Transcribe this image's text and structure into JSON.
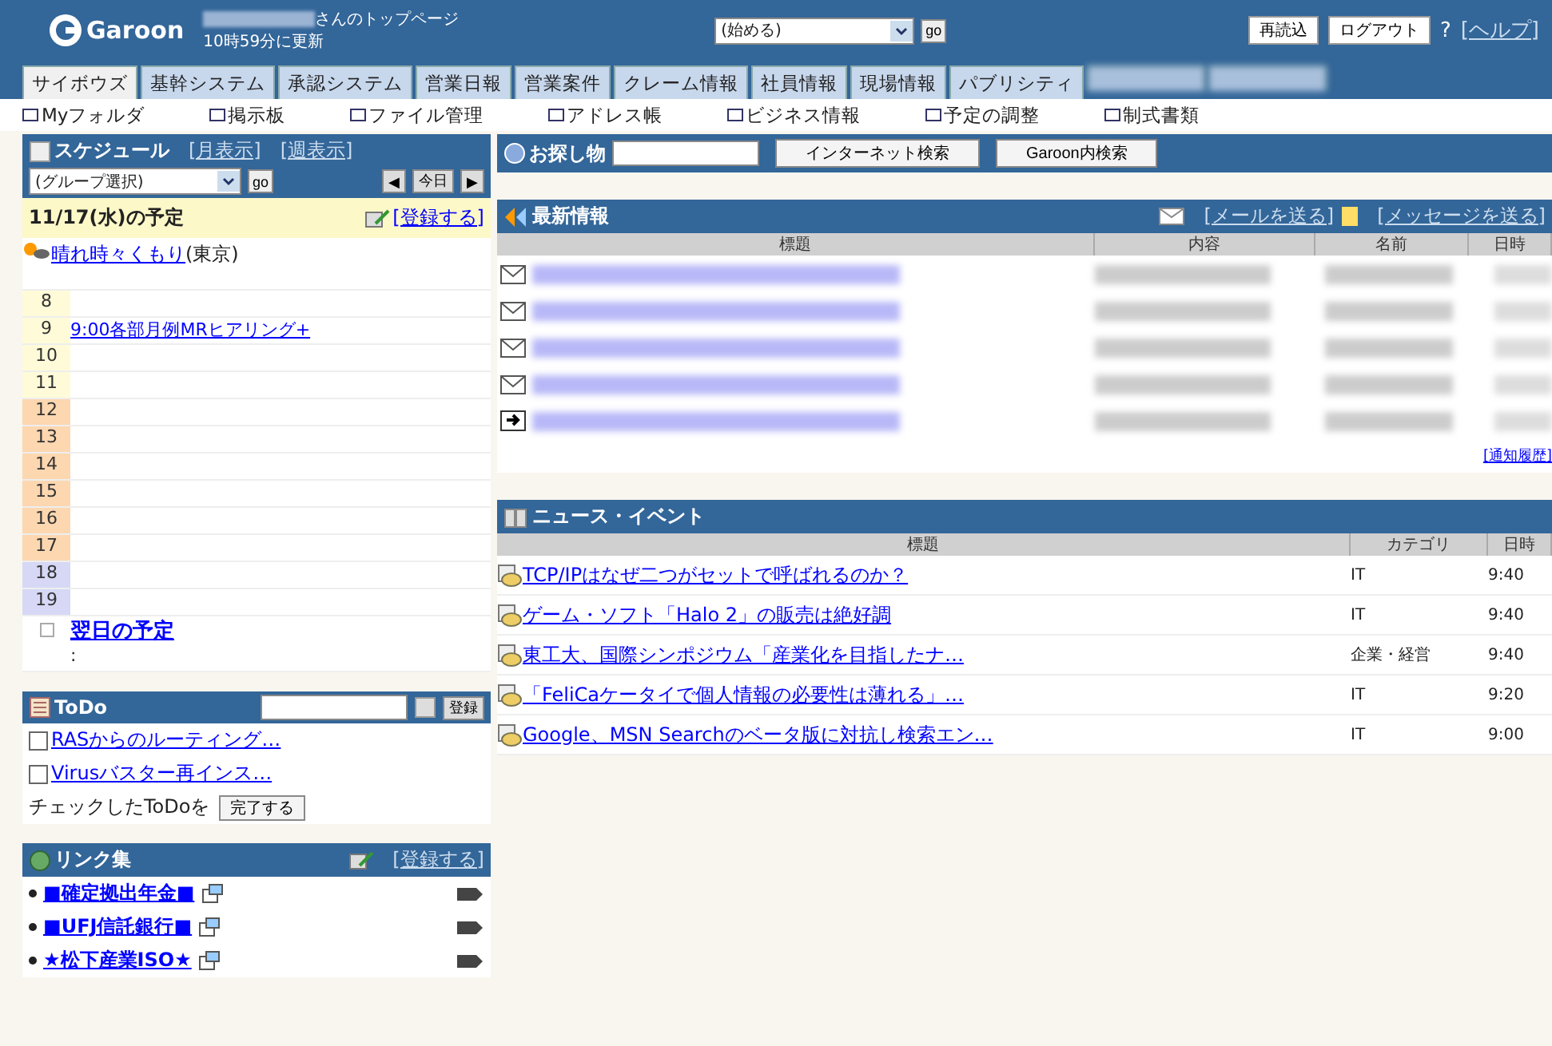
{
  "header": {
    "logo": "Garoon",
    "page_title": "さんのトップページ",
    "updated": "10時59分に更新",
    "menu_select": "(始める)",
    "go": "go",
    "buttons": [
      "再読込",
      "ログアウト"
    ],
    "help_mark": "?",
    "help_link": "[ヘルプ]"
  },
  "tabs": [
    {
      "kind": "text",
      "label": "サイボウズ",
      "selected": true
    },
    {
      "kind": "text",
      "label": "基幹システム",
      "selected": false
    },
    {
      "kind": "text",
      "label": "承認システム",
      "selected": false
    },
    {
      "kind": "text",
      "label": "営業日報",
      "selected": false
    },
    {
      "kind": "text",
      "label": "営業案件",
      "selected": false
    },
    {
      "kind": "text",
      "label": "クレーム情報",
      "selected": false
    },
    {
      "kind": "text",
      "label": "社員情報",
      "selected": false
    },
    {
      "kind": "text",
      "label": "現場情報",
      "selected": false
    },
    {
      "kind": "text",
      "label": "パブリシティ",
      "selected": false
    },
    {
      "kind": "blurred",
      "selected": false
    },
    {
      "kind": "blurred",
      "selected": false
    }
  ],
  "app_links": [
    "Myフォルダ",
    "掲示板",
    "ファイル管理",
    "アドレス帳",
    "ビジネス情報",
    "予定の調整",
    "制式書類"
  ],
  "schedule": {
    "title": "スケジュール",
    "month_view": "[月表示]",
    "week_view": "[週表示]",
    "group_select": "(グループ選択)",
    "go": "go",
    "prev": "◀",
    "today": "今日",
    "next": "▶",
    "date_heading": "11/17(水)の予定",
    "register": "[登録する]",
    "weather": "晴れ時々くもり",
    "weather_place": "(東京)",
    "hours": [
      {
        "hour": "8",
        "color": "#fffbd8"
      },
      {
        "hour": "9",
        "color": "#fffbd8",
        "event": "9:00各部月例MRヒアリング+"
      },
      {
        "hour": "10",
        "color": "#fffbd8"
      },
      {
        "hour": "11",
        "color": "#fffbd8"
      },
      {
        "hour": "12",
        "color": "#fcd7b0"
      },
      {
        "hour": "13",
        "color": "#fcd7b0"
      },
      {
        "hour": "14",
        "color": "#fcd7b0"
      },
      {
        "hour": "15",
        "color": "#fcd7b0"
      },
      {
        "hour": "16",
        "color": "#fcd7b0"
      },
      {
        "hour": "17",
        "color": "#fcd7b0"
      },
      {
        "hour": "18",
        "color": "#d6d8f6"
      },
      {
        "hour": "19",
        "color": "#d6d8f6"
      }
    ],
    "next_day": "翌日の予定",
    "next_day_more": ":"
  },
  "todo": {
    "title": "ToDo",
    "add": "登録",
    "items": [
      {
        "label": "RASからのルーティング…",
        "checked": false
      },
      {
        "label": "Virusバスター再インス…",
        "checked": false
      }
    ],
    "footer": "チェックしたToDoを",
    "complete": "完了する"
  },
  "links": {
    "title": "リンク集",
    "register": "[登録する]",
    "items": [
      "■確定拠出年金■",
      "■UFJ信託銀行■",
      "★松下産業ISO★"
    ]
  },
  "search": {
    "title": "お探し物",
    "buttons": [
      "インターネット検索",
      "Garoon内検索"
    ]
  },
  "latest": {
    "title": "最新情報",
    "send_mail": "[メールを送る]",
    "send_message": "[メッセージを送る]",
    "columns": [
      "標題",
      "内容",
      "名前",
      "日時"
    ],
    "rows": [
      {
        "kind": "mail"
      },
      {
        "kind": "mail"
      },
      {
        "kind": "mail"
      },
      {
        "kind": "mail"
      },
      {
        "kind": "notice"
      }
    ],
    "history": "[通知履歴]"
  },
  "news": {
    "title": "ニュース・イベント",
    "columns": [
      "標題",
      "カテゴリ",
      "日時"
    ],
    "rows": [
      {
        "title": "TCP/IPはなぜ二つがセットで呼ばれるのか？",
        "category": "IT",
        "time": "9:40"
      },
      {
        "title": "ゲーム・ソフト「Halo 2」の販売は絶好調",
        "category": "IT",
        "time": "9:40"
      },
      {
        "title": "東工大、国際シンポジウム「産業化を目指したナ…",
        "category": "企業・経営",
        "time": "9:40"
      },
      {
        "title": "「FeliCaケータイで個人情報の必要性は薄れる」…",
        "category": "IT",
        "time": "9:20"
      },
      {
        "title": "Google、MSN Searchのベータ版に対抗し検索エン…",
        "category": "IT",
        "time": "9:00"
      }
    ]
  }
}
